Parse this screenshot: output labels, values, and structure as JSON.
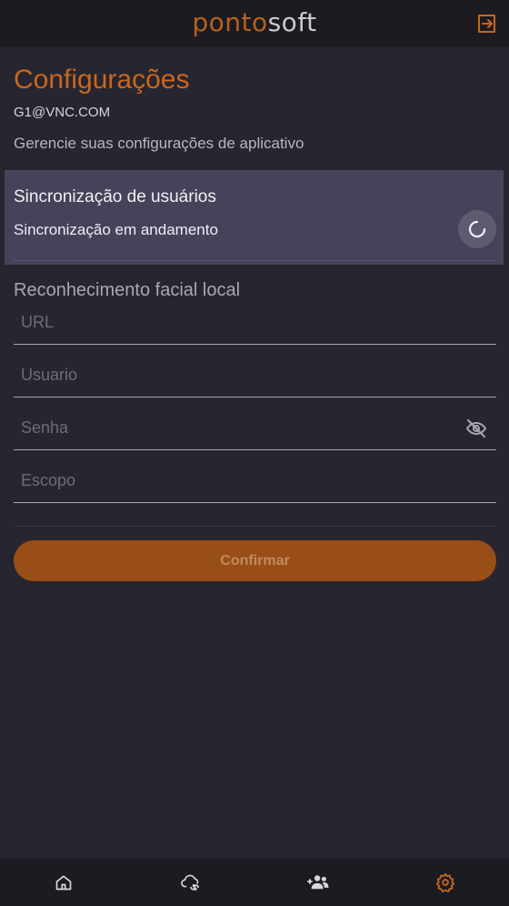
{
  "header": {
    "logo_part1": "ponto",
    "logo_part2": "soft",
    "logout_icon": "logout-icon"
  },
  "page": {
    "title": "Configurações",
    "email": "G1@VNC.COM",
    "subtitle": "Gerencie suas configurações de aplicativo"
  },
  "sync": {
    "title": "Sincronização de usuários",
    "status": "Sincronização em andamento",
    "spinner_icon": "loading-spinner-icon"
  },
  "facial": {
    "title": "Reconhecimento facial local",
    "fields": {
      "url_placeholder": "URL",
      "url_value": "",
      "user_placeholder": "Usuario",
      "user_value": "",
      "password_placeholder": "Senha",
      "password_value": "",
      "scope_placeholder": "Escopo",
      "scope_value": ""
    },
    "password_toggle_icon": "eye-off-icon",
    "confirm_label": "Confirmar"
  },
  "nav": {
    "items": [
      {
        "icon": "home-icon",
        "active": false
      },
      {
        "icon": "cloud-sync-icon",
        "active": false
      },
      {
        "icon": "users-add-icon",
        "active": false
      },
      {
        "icon": "gear-icon",
        "active": true
      }
    ]
  },
  "colors": {
    "accent": "#c8671d",
    "button": "#9a4e17",
    "card": "#45425a",
    "background": "#272530",
    "bar": "#1c1b21"
  }
}
